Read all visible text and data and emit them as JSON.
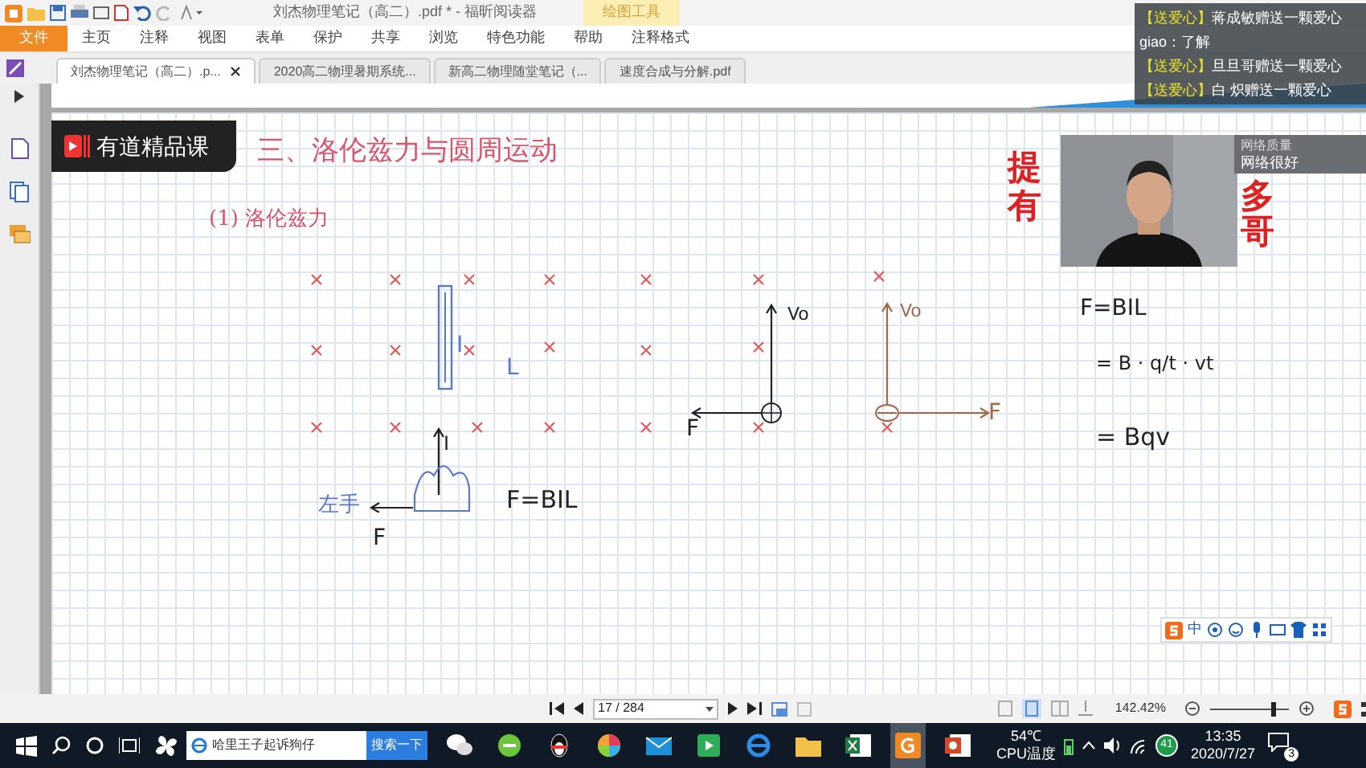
{
  "app": {
    "title": "刘杰物理笔记（高二）.pdf * - 福昕阅读器",
    "tool_tab": "绘图工具"
  },
  "menu": [
    {
      "label": "文件",
      "kind": "file"
    },
    {
      "label": "主页",
      "kind": "tab"
    },
    {
      "label": "注释",
      "kind": "tab"
    },
    {
      "label": "视图",
      "kind": "tab"
    },
    {
      "label": "表单",
      "kind": "tab"
    },
    {
      "label": "保护",
      "kind": "tab"
    },
    {
      "label": "共享",
      "kind": "tab"
    },
    {
      "label": "浏览",
      "kind": "tab"
    },
    {
      "label": "特色功能",
      "kind": "tab"
    },
    {
      "label": "帮助",
      "kind": "tab"
    },
    {
      "label": "注释格式",
      "kind": "tab"
    }
  ],
  "doc_tabs": [
    {
      "label": "刘杰物理笔记（高二）.p...",
      "selected": true
    },
    {
      "label": "2020高二物理暑期系统...",
      "selected": false
    },
    {
      "label": "新高二物理随堂笔记（...",
      "selected": false
    },
    {
      "label": "速度合成与分解.pdf",
      "selected": false
    }
  ],
  "page": {
    "logo": "有道精品课",
    "heading": "三、洛伦兹力与圆周运动",
    "subheading": "(1) 洛伦兹力",
    "notes": [
      "I",
      "L",
      "I",
      "左手",
      "F",
      "F=BIL",
      "Vo",
      "F",
      "Vo",
      "F",
      "F=BIL",
      "= B · q/t · vt",
      "= Bqv"
    ],
    "banner": [
      "提",
      "有",
      "多",
      "哥"
    ]
  },
  "chat": {
    "messages": [
      {
        "kind": "gift",
        "tag": "【送爱心】",
        "text": "蒋成敏赠送一颗爱心"
      },
      {
        "kind": "comment",
        "text": "giao：了解"
      },
      {
        "kind": "gift",
        "tag": "【送爱心】",
        "text": "旦旦哥赠送一颗爱心"
      },
      {
        "kind": "gift",
        "tag": "【送爱心】",
        "text": "白 炽赠送一颗爱心"
      }
    ],
    "network": {
      "label": "网络质量",
      "value": "网络很好"
    }
  },
  "ime": {
    "mode": "中"
  },
  "status_bar": {
    "page": "17 / 284",
    "zoom": "142.42%",
    "level": 0.8
  },
  "taskbar": {
    "search": "哈里王子起诉狗仔",
    "search_button": "搜索一下",
    "temp": "54℃",
    "temp_label": "CPU温度",
    "badge": "41",
    "time": "13:35",
    "date": "2020/7/27",
    "notifications": "3"
  }
}
